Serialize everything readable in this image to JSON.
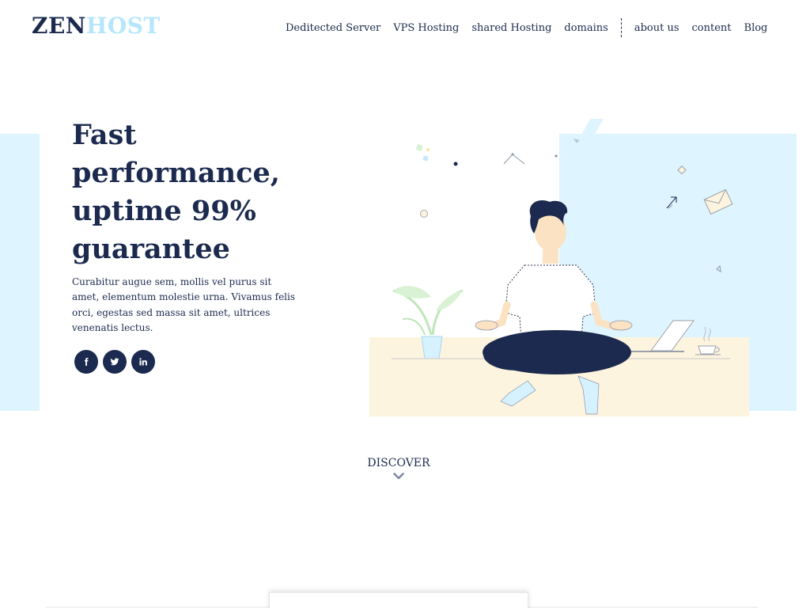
{
  "header": {
    "logo": {
      "part1": "ZEN",
      "part2": "HOST"
    },
    "nav_primary": [
      {
        "label": "Deditected Server"
      },
      {
        "label": "VPS Hosting"
      },
      {
        "label": "shared Hosting"
      },
      {
        "label": "domains"
      }
    ],
    "nav_secondary": [
      {
        "label": "about us"
      },
      {
        "label": "content"
      },
      {
        "label": "Blog"
      }
    ]
  },
  "hero": {
    "headline": "Fast performance, uptime 99% guarantee",
    "description": "Curabitur augue sem, mollis vel purus sit amet, elementum molestie urna. Vivamus felis orci, egestas sed massa sit amet, ultrices venenatis lectus.",
    "socials": [
      {
        "icon": "facebook-icon"
      },
      {
        "icon": "twitter-icon"
      },
      {
        "icon": "linkedin-icon"
      }
    ]
  },
  "discover": {
    "label": "DISCOVER",
    "icon": "chevron-down-icon"
  },
  "colors": {
    "navy": "#1b2a4e",
    "logo_accent": "#b5e6fb",
    "light_blue_panel": "#def4ff",
    "cream_panel": "#fdf4df"
  }
}
